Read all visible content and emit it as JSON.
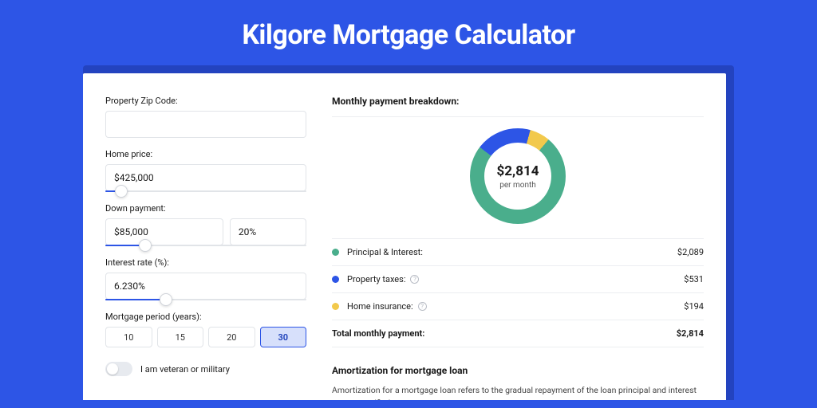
{
  "title": "Kilgore Mortgage Calculator",
  "form": {
    "zip": {
      "label": "Property Zip Code:",
      "value": ""
    },
    "price": {
      "label": "Home price:",
      "value": "$425,000",
      "slider_pct": 8
    },
    "down": {
      "label": "Down payment:",
      "value": "$85,000",
      "pct": "20%",
      "slider_pct": 20
    },
    "rate": {
      "label": "Interest rate (%):",
      "value": "6.230%",
      "slider_pct": 30
    },
    "period": {
      "label": "Mortgage period (years):",
      "options": [
        "10",
        "15",
        "20",
        "30"
      ],
      "active": "30"
    },
    "veteran_label": "I am veteran or military"
  },
  "breakdown": {
    "heading": "Monthly payment breakdown:",
    "center_amount": "$2,814",
    "center_sub": "per month",
    "items": [
      {
        "label": "Principal & Interest:",
        "value": "$2,089",
        "color": "#4aae8c",
        "info": false
      },
      {
        "label": "Property taxes:",
        "value": "$531",
        "color": "#2d55e6",
        "info": true
      },
      {
        "label": "Home insurance:",
        "value": "$194",
        "color": "#f2c94c",
        "info": true
      }
    ],
    "total_label": "Total monthly payment:",
    "total_value": "$2,814"
  },
  "amort": {
    "heading": "Amortization for mortgage loan",
    "body": "Amortization for a mortgage loan refers to the gradual repayment of the loan principal and interest over a specified"
  },
  "chart_data": {
    "type": "pie",
    "title": "Monthly payment breakdown:",
    "series": [
      {
        "name": "Principal & Interest",
        "value": 2089,
        "color": "#4aae8c"
      },
      {
        "name": "Property taxes",
        "value": 531,
        "color": "#2d55e6"
      },
      {
        "name": "Home insurance",
        "value": 194,
        "color": "#f2c94c"
      }
    ],
    "total": 2814,
    "center_label": "$2,814 per month"
  }
}
